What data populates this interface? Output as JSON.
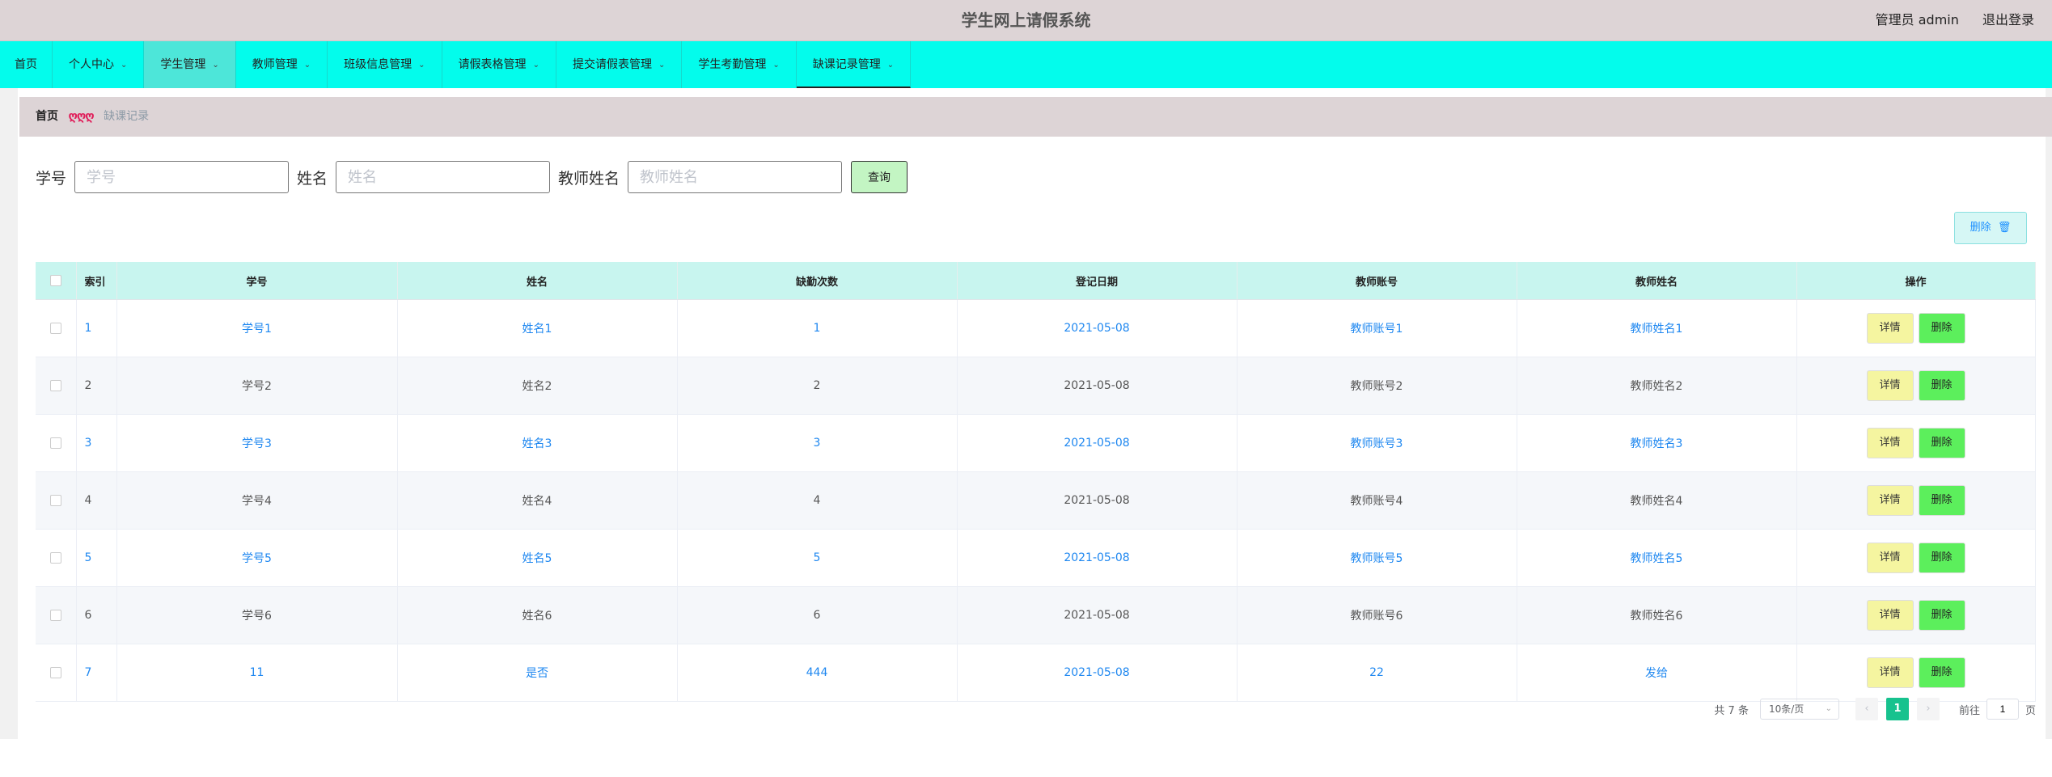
{
  "app": {
    "title": "学生网上请假系统",
    "user_label": "管理员 admin",
    "logout_label": "退出登录"
  },
  "nav": {
    "items": [
      {
        "label": "首页",
        "has_dropdown": false
      },
      {
        "label": "个人中心",
        "has_dropdown": true
      },
      {
        "label": "学生管理",
        "has_dropdown": true
      },
      {
        "label": "教师管理",
        "has_dropdown": true
      },
      {
        "label": "班级信息管理",
        "has_dropdown": true
      },
      {
        "label": "请假表格管理",
        "has_dropdown": true
      },
      {
        "label": "提交请假表管理",
        "has_dropdown": true
      },
      {
        "label": "学生考勤管理",
        "has_dropdown": true
      },
      {
        "label": "缺课记录管理",
        "has_dropdown": true
      }
    ],
    "chevron_icon": "chevron-down-icon"
  },
  "breadcrumb": {
    "home": "首页",
    "separator": "ღღღ",
    "current": "缺课记录"
  },
  "search": {
    "student_no_label": "学号",
    "student_no_placeholder": "学号",
    "student_no_value": "",
    "name_label": "姓名",
    "name_placeholder": "姓名",
    "name_value": "",
    "teacher_name_label": "教师姓名",
    "teacher_name_placeholder": "教师姓名",
    "teacher_name_value": "",
    "query_label": "查询"
  },
  "toolbar": {
    "delete_label": "删除",
    "delete_icon": "trash-icon"
  },
  "table": {
    "headers": [
      "索引",
      "学号",
      "姓名",
      "缺勤次数",
      "登记日期",
      "教师账号",
      "教师姓名",
      "操作"
    ],
    "detail_label": "详情",
    "delete_label": "删除",
    "rows": [
      {
        "index": "1",
        "student_no": "学号1",
        "name": "姓名1",
        "absences": "1",
        "date": "2021-05-08",
        "teacher_account": "教师账号1",
        "teacher_name": "教师姓名1"
      },
      {
        "index": "2",
        "student_no": "学号2",
        "name": "姓名2",
        "absences": "2",
        "date": "2021-05-08",
        "teacher_account": "教师账号2",
        "teacher_name": "教师姓名2"
      },
      {
        "index": "3",
        "student_no": "学号3",
        "name": "姓名3",
        "absences": "3",
        "date": "2021-05-08",
        "teacher_account": "教师账号3",
        "teacher_name": "教师姓名3"
      },
      {
        "index": "4",
        "student_no": "学号4",
        "name": "姓名4",
        "absences": "4",
        "date": "2021-05-08",
        "teacher_account": "教师账号4",
        "teacher_name": "教师姓名4"
      },
      {
        "index": "5",
        "student_no": "学号5",
        "name": "姓名5",
        "absences": "5",
        "date": "2021-05-08",
        "teacher_account": "教师账号5",
        "teacher_name": "教师姓名5"
      },
      {
        "index": "6",
        "student_no": "学号6",
        "name": "姓名6",
        "absences": "6",
        "date": "2021-05-08",
        "teacher_account": "教师账号6",
        "teacher_name": "教师姓名6"
      },
      {
        "index": "7",
        "student_no": "11",
        "name": "是否",
        "absences": "444",
        "date": "2021-05-08",
        "teacher_account": "22",
        "teacher_name": "发给"
      }
    ]
  },
  "pagination": {
    "total_text": "共 7 条",
    "page_size": "10条/页",
    "current_page": "1",
    "goto_label": "前往",
    "goto_value": "1",
    "page_suffix": "页"
  },
  "colors": {
    "nav_bg": "#03fcec",
    "header_bg": "#ddd4d6",
    "table_header_bg": "#c8f5ef",
    "accent": "#17c28e",
    "link": "#1e87f0"
  }
}
